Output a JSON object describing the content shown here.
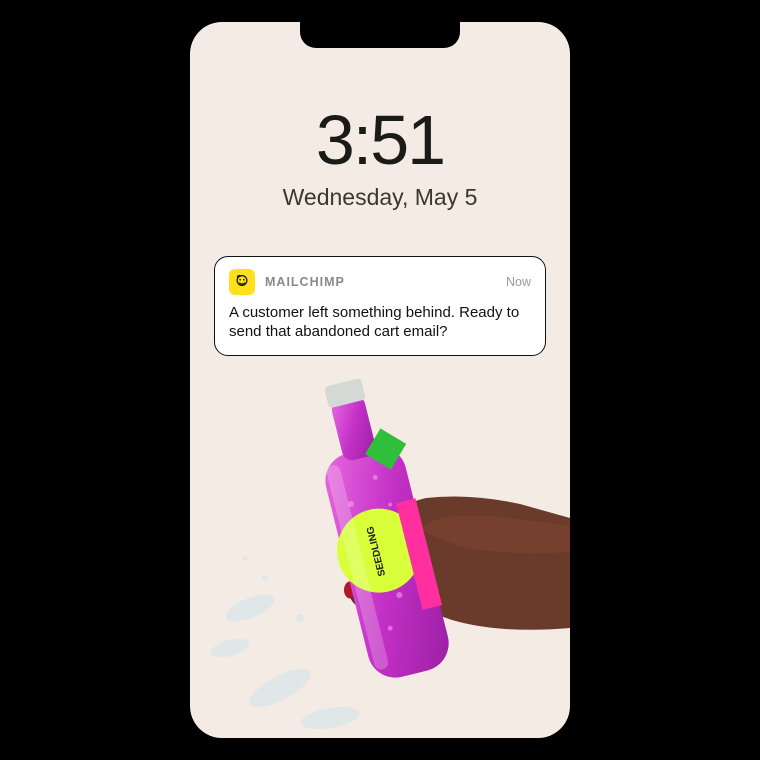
{
  "lockscreen": {
    "time": "3:51",
    "date": "Wednesday, May 5"
  },
  "notification": {
    "app_name": "MAILCHIMP",
    "relative_time": "Now",
    "body": "A customer left something behind. Ready to send that abandoned cart email?",
    "icon_color": "#ffe01b"
  },
  "wallpaper": {
    "description": "hand-holding-bottle",
    "bottle_brand": "SEEDLING",
    "bottle_color": "#c330c6"
  }
}
